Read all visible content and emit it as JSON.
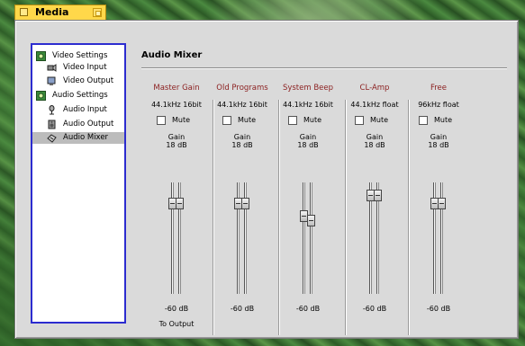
{
  "window": {
    "tab_title": "Media"
  },
  "sidebar": {
    "items": [
      {
        "label": "Video Settings",
        "icon": "settings-icon",
        "level": 0
      },
      {
        "label": "Video Input",
        "icon": "camera-icon",
        "level": 1
      },
      {
        "label": "Video Output",
        "icon": "monitor-icon",
        "level": 1
      },
      {
        "label": "Audio Settings",
        "icon": "settings-icon",
        "level": 0
      },
      {
        "label": "Audio Input",
        "icon": "microphone-icon",
        "level": 1
      },
      {
        "label": "Audio Output",
        "icon": "speaker-icon",
        "level": 1
      },
      {
        "label": "Audio Mixer",
        "icon": "mixer-icon",
        "level": 1,
        "selected": true
      }
    ]
  },
  "panel": {
    "title": "Audio Mixer"
  },
  "channels": [
    {
      "name": "Master Gain",
      "format": "44.1kHz 16bit",
      "mute_label": "Mute",
      "muted": false,
      "gain_label": "Gain",
      "gain_value": "18 dB",
      "min_label": "-60 dB",
      "output_label": "To Output",
      "level": 0.85
    },
    {
      "name": "Old Programs",
      "format": "44.1kHz 16bit",
      "mute_label": "Mute",
      "muted": false,
      "gain_label": "Gain",
      "gain_value": "18 dB",
      "min_label": "-60 dB",
      "level": 0.85
    },
    {
      "name": "System Beep",
      "format": "44.1kHz 16bit",
      "mute_label": "Mute",
      "muted": false,
      "gain_label": "Gain",
      "gain_value": "18 dB",
      "min_label": "-60 dB",
      "level": 0.72,
      "level_right": 0.68
    },
    {
      "name": "CL-Amp",
      "format": "44.1kHz float",
      "mute_label": "Mute",
      "muted": false,
      "gain_label": "Gain",
      "gain_value": "18 dB",
      "min_label": "-60 dB",
      "level": 0.93
    },
    {
      "name": "Free",
      "format": "96kHz float",
      "mute_label": "Mute",
      "muted": false,
      "gain_label": "Gain",
      "gain_value": "18 dB",
      "min_label": "-60 dB",
      "level": 0.85
    }
  ],
  "colors": {
    "sidebar_border": "#2c2ccf",
    "channel_name": "#8b1f1f",
    "tab": "#ffd84a"
  }
}
